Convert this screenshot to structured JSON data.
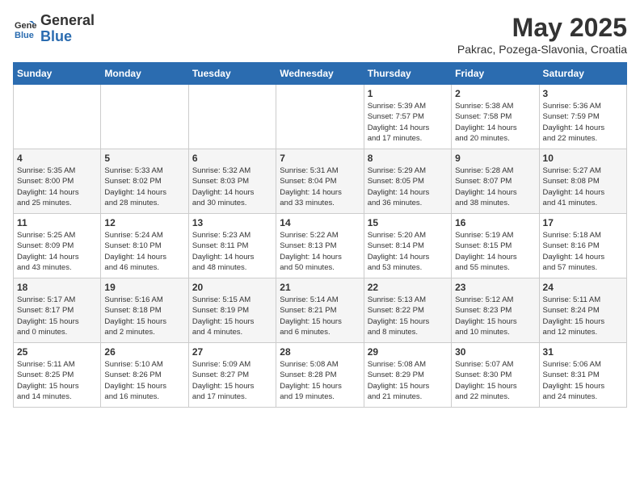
{
  "header": {
    "logo_general": "General",
    "logo_blue": "Blue",
    "month_title": "May 2025",
    "location": "Pakrac, Pozega-Slavonia, Croatia"
  },
  "days_of_week": [
    "Sunday",
    "Monday",
    "Tuesday",
    "Wednesday",
    "Thursday",
    "Friday",
    "Saturday"
  ],
  "weeks": [
    [
      {
        "day": "",
        "info": ""
      },
      {
        "day": "",
        "info": ""
      },
      {
        "day": "",
        "info": ""
      },
      {
        "day": "",
        "info": ""
      },
      {
        "day": "1",
        "info": "Sunrise: 5:39 AM\nSunset: 7:57 PM\nDaylight: 14 hours\nand 17 minutes."
      },
      {
        "day": "2",
        "info": "Sunrise: 5:38 AM\nSunset: 7:58 PM\nDaylight: 14 hours\nand 20 minutes."
      },
      {
        "day": "3",
        "info": "Sunrise: 5:36 AM\nSunset: 7:59 PM\nDaylight: 14 hours\nand 22 minutes."
      }
    ],
    [
      {
        "day": "4",
        "info": "Sunrise: 5:35 AM\nSunset: 8:00 PM\nDaylight: 14 hours\nand 25 minutes."
      },
      {
        "day": "5",
        "info": "Sunrise: 5:33 AM\nSunset: 8:02 PM\nDaylight: 14 hours\nand 28 minutes."
      },
      {
        "day": "6",
        "info": "Sunrise: 5:32 AM\nSunset: 8:03 PM\nDaylight: 14 hours\nand 30 minutes."
      },
      {
        "day": "7",
        "info": "Sunrise: 5:31 AM\nSunset: 8:04 PM\nDaylight: 14 hours\nand 33 minutes."
      },
      {
        "day": "8",
        "info": "Sunrise: 5:29 AM\nSunset: 8:05 PM\nDaylight: 14 hours\nand 36 minutes."
      },
      {
        "day": "9",
        "info": "Sunrise: 5:28 AM\nSunset: 8:07 PM\nDaylight: 14 hours\nand 38 minutes."
      },
      {
        "day": "10",
        "info": "Sunrise: 5:27 AM\nSunset: 8:08 PM\nDaylight: 14 hours\nand 41 minutes."
      }
    ],
    [
      {
        "day": "11",
        "info": "Sunrise: 5:25 AM\nSunset: 8:09 PM\nDaylight: 14 hours\nand 43 minutes."
      },
      {
        "day": "12",
        "info": "Sunrise: 5:24 AM\nSunset: 8:10 PM\nDaylight: 14 hours\nand 46 minutes."
      },
      {
        "day": "13",
        "info": "Sunrise: 5:23 AM\nSunset: 8:11 PM\nDaylight: 14 hours\nand 48 minutes."
      },
      {
        "day": "14",
        "info": "Sunrise: 5:22 AM\nSunset: 8:13 PM\nDaylight: 14 hours\nand 50 minutes."
      },
      {
        "day": "15",
        "info": "Sunrise: 5:20 AM\nSunset: 8:14 PM\nDaylight: 14 hours\nand 53 minutes."
      },
      {
        "day": "16",
        "info": "Sunrise: 5:19 AM\nSunset: 8:15 PM\nDaylight: 14 hours\nand 55 minutes."
      },
      {
        "day": "17",
        "info": "Sunrise: 5:18 AM\nSunset: 8:16 PM\nDaylight: 14 hours\nand 57 minutes."
      }
    ],
    [
      {
        "day": "18",
        "info": "Sunrise: 5:17 AM\nSunset: 8:17 PM\nDaylight: 15 hours\nand 0 minutes."
      },
      {
        "day": "19",
        "info": "Sunrise: 5:16 AM\nSunset: 8:18 PM\nDaylight: 15 hours\nand 2 minutes."
      },
      {
        "day": "20",
        "info": "Sunrise: 5:15 AM\nSunset: 8:19 PM\nDaylight: 15 hours\nand 4 minutes."
      },
      {
        "day": "21",
        "info": "Sunrise: 5:14 AM\nSunset: 8:21 PM\nDaylight: 15 hours\nand 6 minutes."
      },
      {
        "day": "22",
        "info": "Sunrise: 5:13 AM\nSunset: 8:22 PM\nDaylight: 15 hours\nand 8 minutes."
      },
      {
        "day": "23",
        "info": "Sunrise: 5:12 AM\nSunset: 8:23 PM\nDaylight: 15 hours\nand 10 minutes."
      },
      {
        "day": "24",
        "info": "Sunrise: 5:11 AM\nSunset: 8:24 PM\nDaylight: 15 hours\nand 12 minutes."
      }
    ],
    [
      {
        "day": "25",
        "info": "Sunrise: 5:11 AM\nSunset: 8:25 PM\nDaylight: 15 hours\nand 14 minutes."
      },
      {
        "day": "26",
        "info": "Sunrise: 5:10 AM\nSunset: 8:26 PM\nDaylight: 15 hours\nand 16 minutes."
      },
      {
        "day": "27",
        "info": "Sunrise: 5:09 AM\nSunset: 8:27 PM\nDaylight: 15 hours\nand 17 minutes."
      },
      {
        "day": "28",
        "info": "Sunrise: 5:08 AM\nSunset: 8:28 PM\nDaylight: 15 hours\nand 19 minutes."
      },
      {
        "day": "29",
        "info": "Sunrise: 5:08 AM\nSunset: 8:29 PM\nDaylight: 15 hours\nand 21 minutes."
      },
      {
        "day": "30",
        "info": "Sunrise: 5:07 AM\nSunset: 8:30 PM\nDaylight: 15 hours\nand 22 minutes."
      },
      {
        "day": "31",
        "info": "Sunrise: 5:06 AM\nSunset: 8:31 PM\nDaylight: 15 hours\nand 24 minutes."
      }
    ]
  ]
}
